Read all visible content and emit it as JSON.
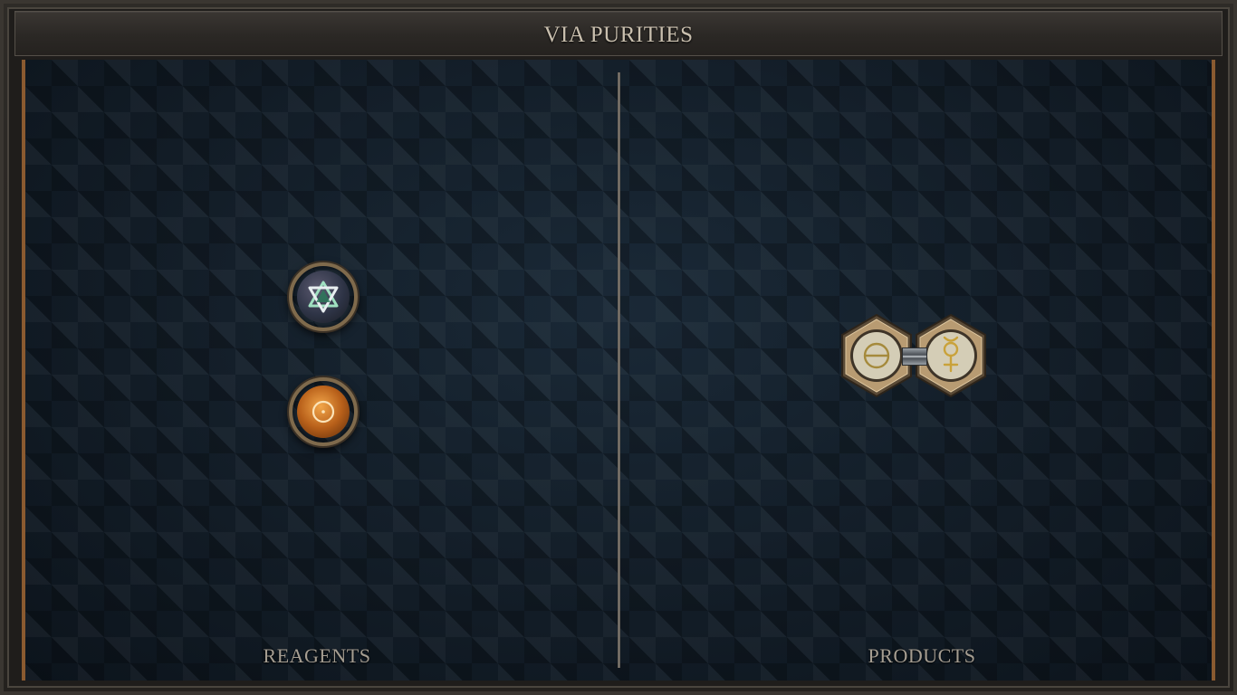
{
  "window": {
    "title": "VIA PURITIES"
  },
  "reagents": {
    "label": "REAGENTS",
    "atoms": [
      {
        "element": "salt",
        "icon": "salt-icon",
        "symbol": "✡"
      },
      {
        "element": "gold",
        "icon": "gold-icon",
        "symbol": "☉"
      }
    ]
  },
  "products": {
    "label": "PRODUCTS",
    "molecule": {
      "atoms": [
        {
          "element": "salt",
          "icon": "salt-icon",
          "symbol": "⊖"
        },
        {
          "element": "quicksilver",
          "icon": "quicksilver-icon",
          "symbol": "☿"
        }
      ],
      "bonds": 1
    }
  },
  "colors": {
    "board": "#121d28",
    "accent_trim": "#8a5a30",
    "label_text": "#a59d91",
    "title_text": "#c9bfae"
  }
}
